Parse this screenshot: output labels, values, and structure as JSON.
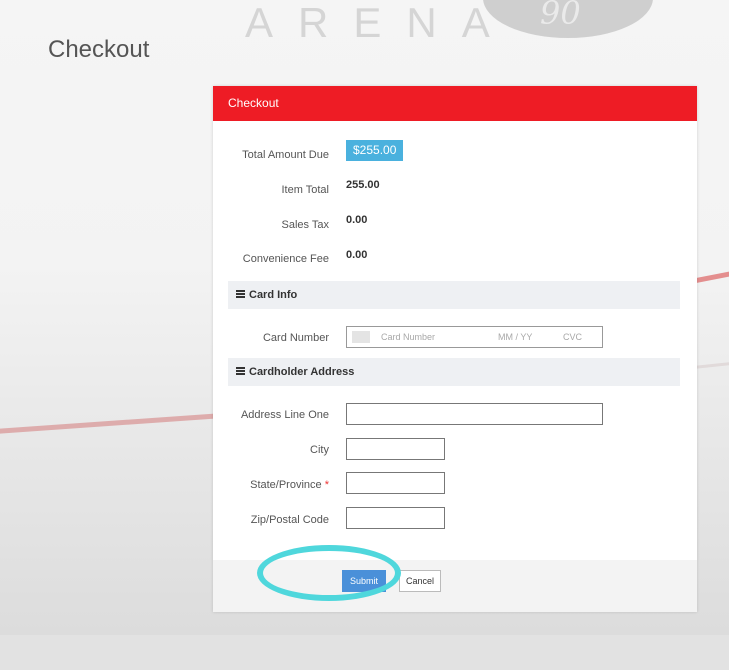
{
  "background": {
    "arena_text": "ARENA",
    "emblem_text": "90"
  },
  "page": {
    "title": "Checkout"
  },
  "card": {
    "header_title": "Checkout",
    "header_color": "#ee1c25",
    "summary": {
      "total_label": "Total Amount Due",
      "total_value": "$255.00",
      "item_total_label": "Item Total",
      "item_total_value": "255.00",
      "sales_tax_label": "Sales Tax",
      "sales_tax_value": "0.00",
      "convenience_fee_label": "Convenience Fee",
      "convenience_fee_value": "0.00"
    },
    "card_info": {
      "section_title": "Card Info",
      "card_number_label": "Card Number",
      "card_number_placeholder": "Card Number",
      "expiry_placeholder": "MM / YY",
      "cvc_placeholder": "CVC"
    },
    "address": {
      "section_title": "Cardholder Address",
      "line_one_label": "Address Line One",
      "city_label": "City",
      "state_label": "State/Province",
      "state_required_marker": "*",
      "zip_label": "Zip/Postal Code"
    },
    "actions": {
      "submit_label": "Submit",
      "cancel_label": "Cancel"
    }
  },
  "annotation": {
    "highlight_color": "#4fd7dc",
    "highlight_target": "submit-button"
  }
}
